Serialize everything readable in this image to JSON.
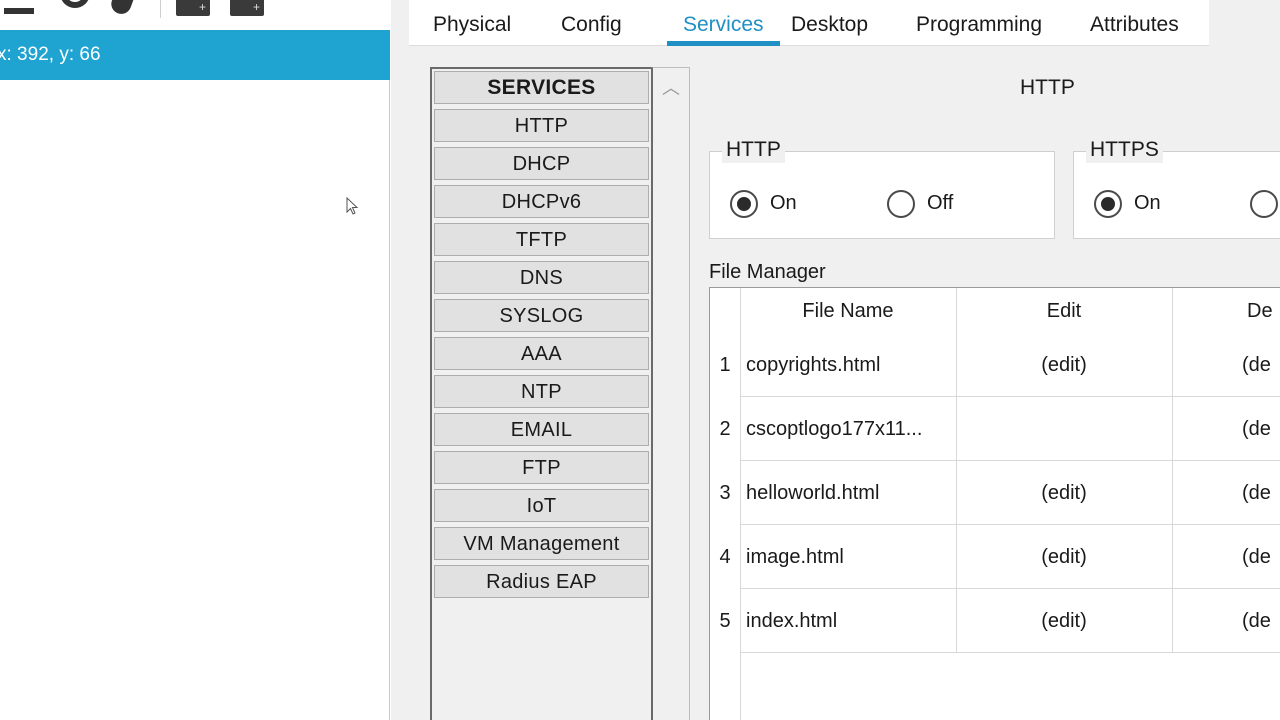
{
  "workspace": {
    "coords_text": "x: 392, y: 66"
  },
  "tabs": [
    {
      "label": "Physical"
    },
    {
      "label": "Config"
    },
    {
      "label": "Services"
    },
    {
      "label": "Desktop"
    },
    {
      "label": "Programming"
    },
    {
      "label": "Attributes"
    }
  ],
  "active_tab": "Services",
  "services": {
    "header": "SERVICES",
    "items": [
      {
        "label": "HTTP"
      },
      {
        "label": "DHCP"
      },
      {
        "label": "DHCPv6"
      },
      {
        "label": "TFTP"
      },
      {
        "label": "DNS"
      },
      {
        "label": "SYSLOG"
      },
      {
        "label": "AAA"
      },
      {
        "label": "NTP"
      },
      {
        "label": "EMAIL"
      },
      {
        "label": "FTP"
      },
      {
        "label": "IoT"
      },
      {
        "label": "VM Management"
      },
      {
        "label": "Radius EAP"
      }
    ]
  },
  "http_panel": {
    "title": "HTTP",
    "http_group": {
      "label": "HTTP",
      "on_label": "On",
      "off_label": "Off",
      "selected": "On"
    },
    "https_group": {
      "label": "HTTPS",
      "on_label": "On",
      "selected": "On"
    },
    "file_manager": {
      "label": "File Manager",
      "columns": {
        "name": "File Name",
        "edit": "Edit",
        "delete": "De"
      },
      "rows": [
        {
          "num": "1",
          "name": "copyrights.html",
          "edit": "(edit)",
          "delete": "(de"
        },
        {
          "num": "2",
          "name": "cscoptlogo177x11...",
          "edit": "",
          "delete": "(de"
        },
        {
          "num": "3",
          "name": "helloworld.html",
          "edit": "(edit)",
          "delete": "(de"
        },
        {
          "num": "4",
          "name": "image.html",
          "edit": "(edit)",
          "delete": "(de"
        },
        {
          "num": "5",
          "name": "index.html",
          "edit": "(edit)",
          "delete": "(de"
        }
      ]
    }
  },
  "colors": {
    "accent": "#1f8fc4",
    "coord_bar": "#1fa3d1"
  }
}
